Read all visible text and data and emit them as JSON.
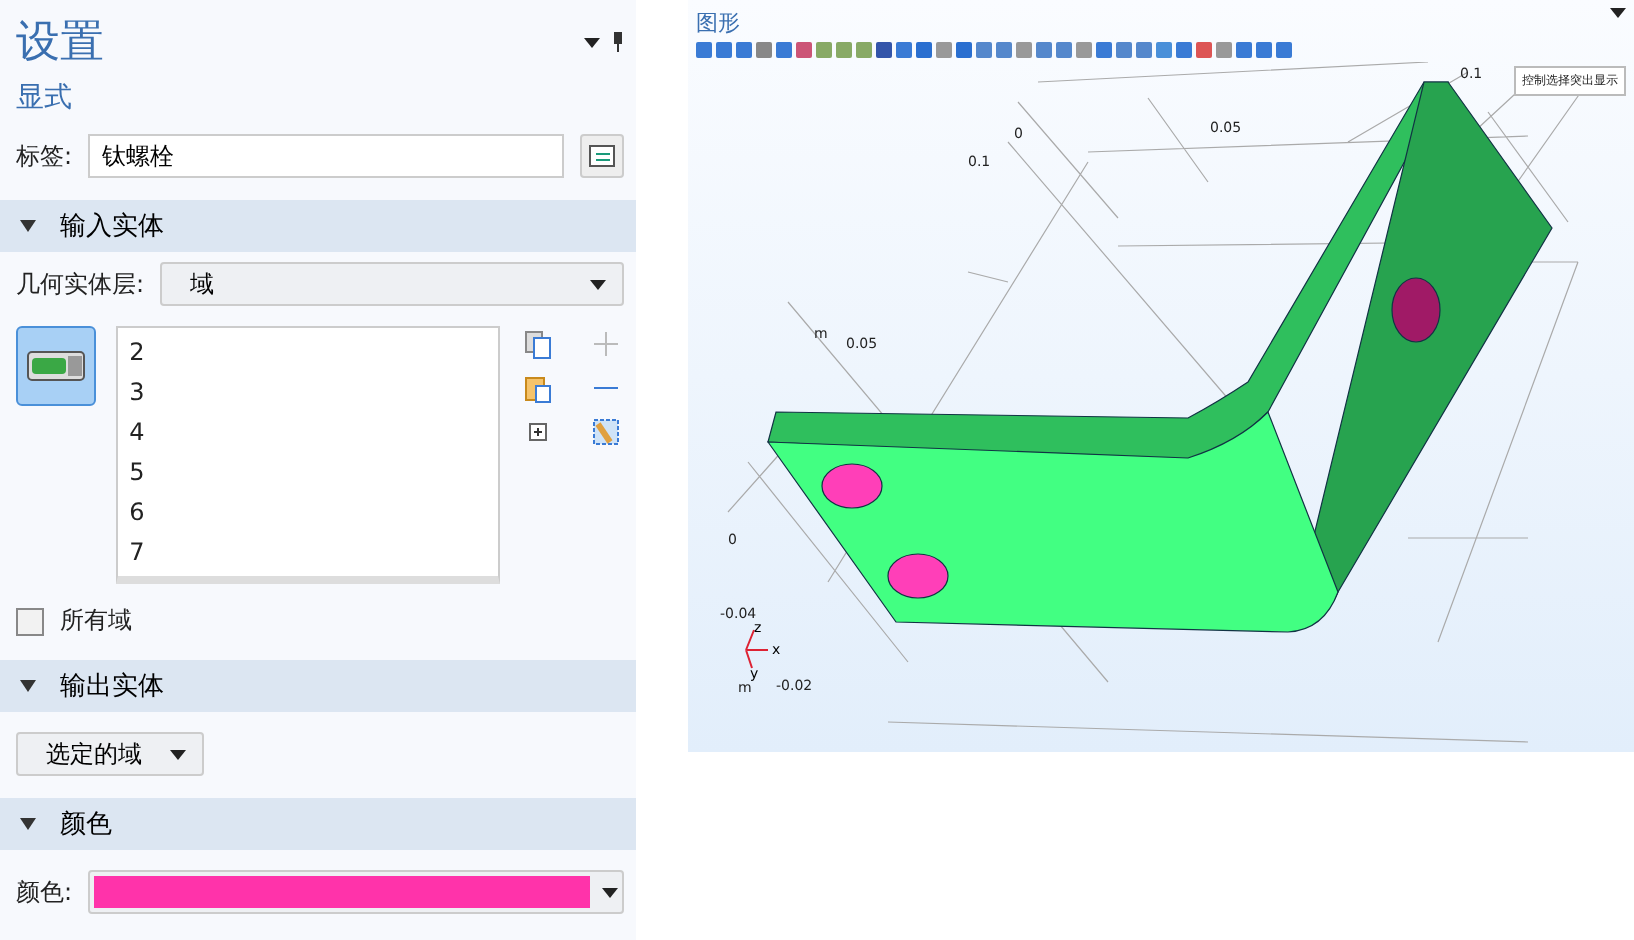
{
  "settings": {
    "title": "设置",
    "subtitle": "显式",
    "label_field": {
      "label": "标签:",
      "value": "钛螺栓"
    }
  },
  "sections": [
    {
      "kind": "input",
      "title": "输入实体",
      "expanded": true,
      "level_label": "几何实体层:",
      "level_value": "域",
      "selection_active": true,
      "items": [
        "2",
        "3",
        "4",
        "5",
        "6",
        "7"
      ],
      "all_domains": {
        "label": "所有域",
        "checked": false
      }
    },
    {
      "kind": "output",
      "title": "输出实体",
      "expanded": true,
      "value": "选定的域"
    },
    {
      "kind": "color",
      "title": "颜色",
      "expanded": true,
      "label": "颜色:",
      "color": "#ff33aa"
    }
  ],
  "graphics": {
    "title": "图形",
    "tooltip": "控制选择突出显示",
    "axis_labels": [
      "0.1",
      "0",
      "0.05",
      "0.1",
      "m",
      "0.05",
      "0",
      "-0.04",
      "m",
      "-0.02"
    ],
    "triad": [
      "z",
      "x",
      "y"
    ]
  }
}
